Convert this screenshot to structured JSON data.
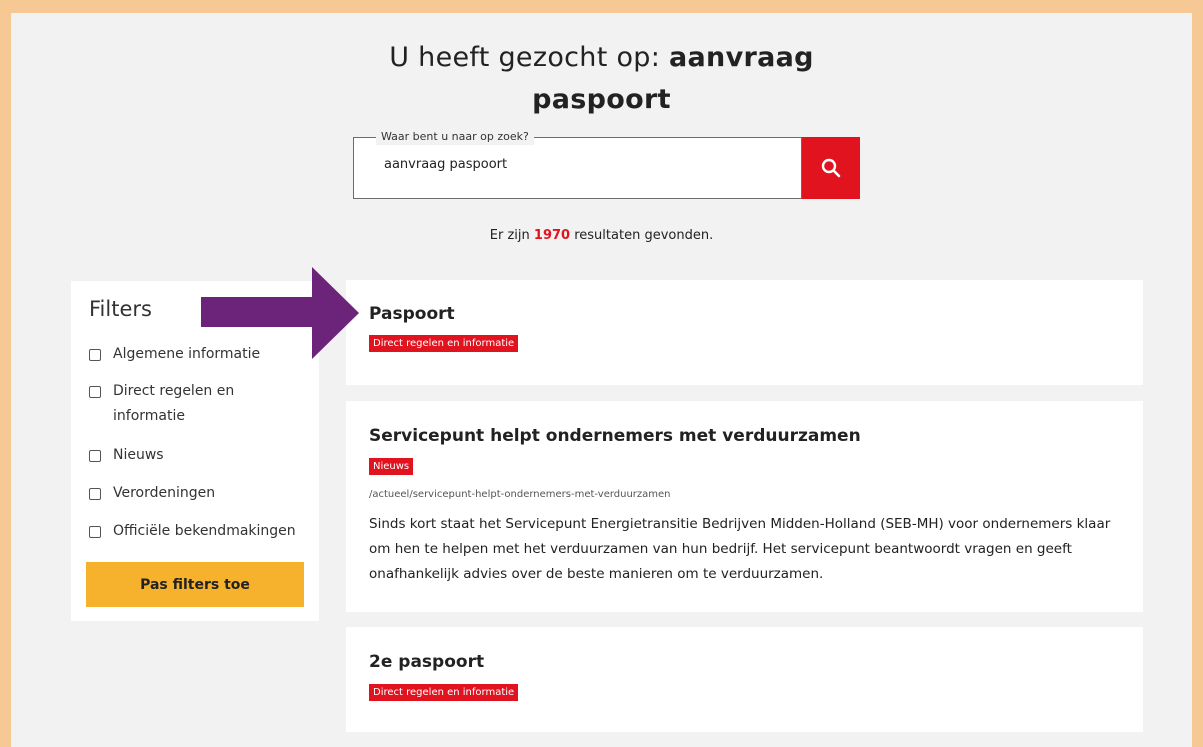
{
  "header": {
    "title_prefix": "U heeft gezocht op: ",
    "title_query_line1": "aanvraag",
    "title_query_line2": "paspoort"
  },
  "search": {
    "label": "Waar bent u naar op zoek?",
    "value": "aanvraag paspoort",
    "button_icon": "search-icon",
    "button_color": "#e0131f"
  },
  "results_summary": {
    "prefix": "Er zijn ",
    "count": "1970",
    "suffix": " resultaten gevonden."
  },
  "filters": {
    "title": "Filters",
    "items": [
      {
        "label": "Algemene informatie",
        "checked": false
      },
      {
        "label": "Direct regelen en",
        "label_line2": "informatie",
        "checked": false
      },
      {
        "label": "Nieuws",
        "checked": false
      },
      {
        "label": "Verordeningen",
        "checked": false
      },
      {
        "label": "Officiële bekendmakingen",
        "checked": false
      }
    ],
    "apply_label": "Pas filters toe",
    "apply_color": "#f6b22d"
  },
  "results": [
    {
      "title": "Paspoort",
      "tag": "Direct regelen en informatie"
    },
    {
      "title": "Servicepunt helpt ondernemers met verduurzamen",
      "tag": "Nieuws",
      "url": "/actueel/servicepunt-helpt-ondernemers-met-verduurzamen",
      "description_lines": [
        "Sinds kort staat het Servicepunt Energietransitie Bedrijven Midden-Holland (SEB-MH) voor ondernemers klaar",
        "om hen te helpen met het verduurzamen van hun bedrijf. Het servicepunt beantwoordt vragen en geeft",
        "onafhankelijk advies over de beste manieren om te verduurzamen."
      ]
    },
    {
      "title": "2e paspoort",
      "tag": "Direct regelen en informatie"
    }
  ],
  "annotation": {
    "arrow_icon": "right-arrow-icon",
    "arrow_color": "#6b2479"
  },
  "colors": {
    "frame_border": "#f6c994",
    "page_background": "#f2f2f2",
    "accent": "#e0131f"
  }
}
